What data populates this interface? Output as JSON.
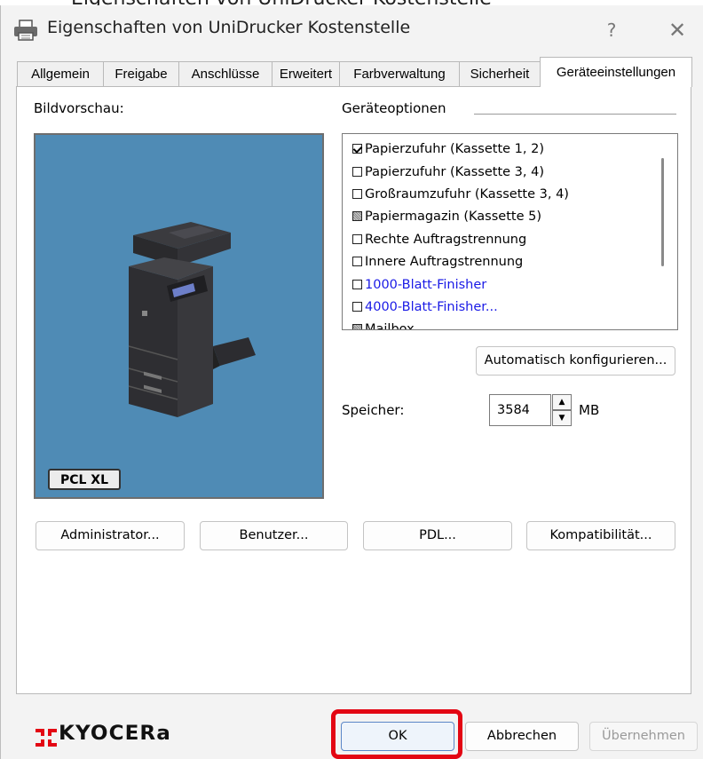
{
  "clipped_top_text": "Eigenschaften von UniDrucker Kostenstelle",
  "window": {
    "title": "Eigenschaften von UniDrucker Kostenstelle",
    "help_label": "?",
    "close_label": "✕"
  },
  "tabs": [
    {
      "label": "Allgemein"
    },
    {
      "label": "Freigabe"
    },
    {
      "label": "Anschlüsse"
    },
    {
      "label": "Erweitert"
    },
    {
      "label": "Farbverwaltung"
    },
    {
      "label": "Sicherheit"
    },
    {
      "label": "Geräteeinstellungen",
      "active": true
    }
  ],
  "preview": {
    "label": "Bildvorschau:",
    "badge": "PCL XL"
  },
  "options": {
    "label": "Geräteoptionen",
    "items": [
      {
        "label": "Papierzufuhr (Kassette 1, 2)",
        "state": "checked"
      },
      {
        "label": "Papierzufuhr (Kassette 3, 4)",
        "state": "unchecked"
      },
      {
        "label": "Großraumzufuhr (Kassette 3, 4)",
        "state": "unchecked"
      },
      {
        "label": "Papiermagazin (Kassette 5)",
        "state": "partial"
      },
      {
        "label": "Rechte Auftragstrennung",
        "state": "unchecked"
      },
      {
        "label": "Innere Auftragstrennung",
        "state": "unchecked"
      },
      {
        "label": "1000-Blatt-Finisher",
        "state": "unchecked",
        "color": "#1a1ae6"
      },
      {
        "label": "4000-Blatt-Finisher...",
        "state": "unchecked",
        "color": "#1a1ae6"
      },
      {
        "label": "Mailbox",
        "state": "partial"
      }
    ],
    "auto_config_label": "Automatisch konfigurieren..."
  },
  "memory": {
    "label": "Speicher:",
    "value": "3584",
    "unit": "MB"
  },
  "action_buttons": {
    "admin": "Administrator...",
    "user": "Benutzer...",
    "pdl": "PDL...",
    "compat": "Kompatibilität..."
  },
  "footer": {
    "logo_text": "KYOCERa",
    "ok": "OK",
    "cancel": "Abbrechen",
    "apply": "Übernehmen"
  },
  "colors": {
    "preview_bg": "#4f8bb5",
    "highlight": "#e30613",
    "link_blue": "#1a1ae6",
    "logo_red": "#e30613"
  }
}
